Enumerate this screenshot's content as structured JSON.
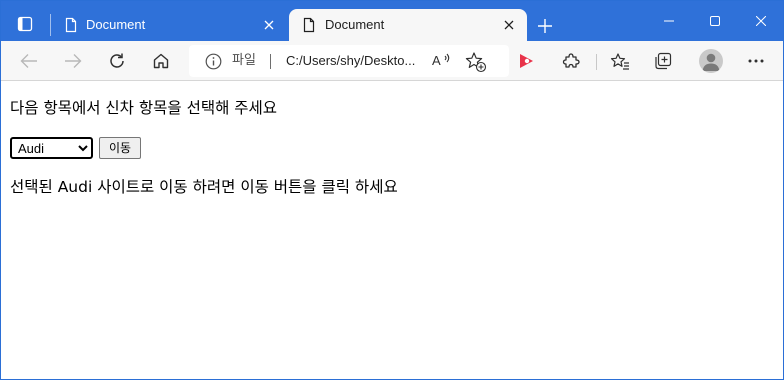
{
  "browser": {
    "tabs": [
      {
        "title": "Document",
        "active": false
      },
      {
        "title": "Document",
        "active": true
      }
    ],
    "address_bar": {
      "scheme_label": "파일",
      "url": "C:/Users/shy/Deskto..."
    },
    "colors": {
      "titlebar": "#2f71d9",
      "toolbar": "#f7f7f7",
      "video_icon": "#e8334a"
    },
    "icons": {
      "tab_actions": "tab-actions-icon",
      "page": "document-icon",
      "close": "close-icon",
      "new_tab": "plus-icon",
      "back": "back-arrow-icon",
      "forward": "forward-arrow-icon",
      "refresh": "refresh-icon",
      "home": "home-icon",
      "info": "info-icon",
      "read_aloud": "read-aloud-icon",
      "add_favorite": "add-favorite-icon",
      "video": "video-icon",
      "extensions": "puzzle-icon",
      "favorites": "favorites-icon",
      "collections": "collections-icon",
      "profile": "profile-icon",
      "more": "more-icon"
    }
  },
  "page": {
    "heading": "다음 항목에서 신차 항목을 선택해 주세요",
    "select": {
      "selected": "Audi"
    },
    "button_label": "이동",
    "result": "선택된 Audi 사이트로 이동 하려면 이동 버튼을 클릭 하세요"
  }
}
